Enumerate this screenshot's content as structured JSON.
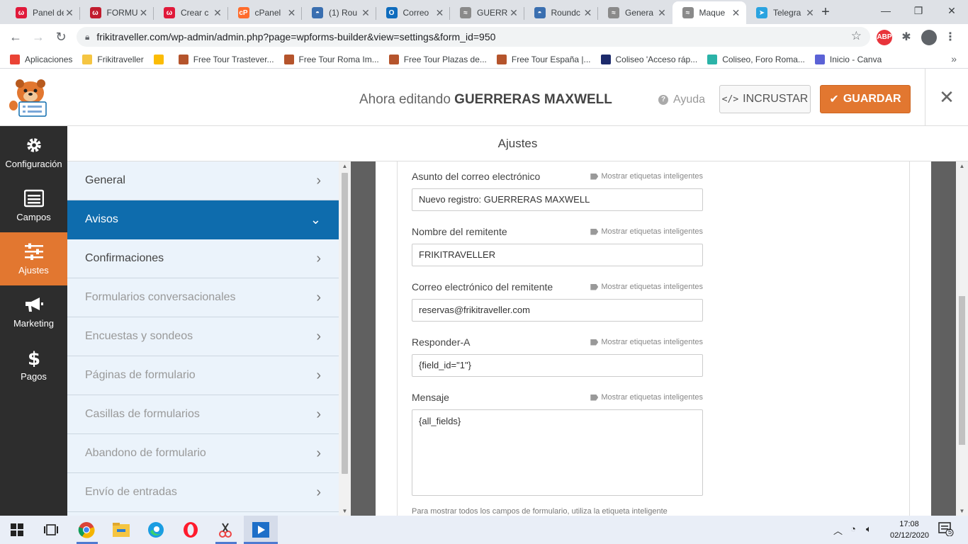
{
  "browser": {
    "tabs": [
      {
        "title": "Panel de",
        "icon_color": "#e0193a",
        "glyph": "ω"
      },
      {
        "title": "FORMUL",
        "icon_color": "#c11c2e",
        "glyph": "ω"
      },
      {
        "title": "Crear c",
        "icon_color": "#e0193a",
        "glyph": "ω"
      },
      {
        "title": "cPanel",
        "icon_color": "#ff6c2c",
        "glyph": "cP"
      },
      {
        "title": "(1) Rou",
        "icon_color": "#3a6fb0",
        "glyph": "◓"
      },
      {
        "title": "Correo",
        "icon_color": "#0f6cbd",
        "glyph": "O"
      },
      {
        "title": "GUERR",
        "icon_color": "#8a8a8a",
        "glyph": "≈"
      },
      {
        "title": "Roundc",
        "icon_color": "#3a6fb0",
        "glyph": "◓"
      },
      {
        "title": "Genera",
        "icon_color": "#8a8a8a",
        "glyph": "≈"
      },
      {
        "title": "Maque",
        "icon_color": "#8a8a8a",
        "glyph": "≈"
      },
      {
        "title": "Telegra",
        "icon_color": "#2aa3e0",
        "glyph": "➤"
      }
    ],
    "close_glyph": "✕",
    "new_tab_glyph": "+",
    "url": "frikitraveller.com/wp-admin/admin.php?page=wpforms-builder&view=settings&form_id=950",
    "abp_label": "ABP",
    "bookmarks": [
      {
        "label": "Aplicaciones",
        "color": "#ea4335"
      },
      {
        "label": "Frikitraveller",
        "color": "#f5c542"
      },
      {
        "label": "",
        "color": "#fbbc05"
      },
      {
        "label": "Free Tour Trastever...",
        "color": "#b5542c"
      },
      {
        "label": "Free Tour Roma Im...",
        "color": "#b5542c"
      },
      {
        "label": "Free Tour Plazas de...",
        "color": "#b5542c"
      },
      {
        "label": "Free Tour España |...",
        "color": "#b5542c"
      },
      {
        "label": "Coliseo 'Acceso ráp...",
        "color": "#1c2a6b"
      },
      {
        "label": "Coliseo, Foro Roma...",
        "color": "#2bb3a8"
      },
      {
        "label": "Inicio - Canva",
        "color": "#5b62d6"
      }
    ]
  },
  "header": {
    "editing_prefix": "Ahora editando",
    "form_name": "GUERRERAS MAXWELL",
    "help_label": "Ayuda",
    "embed_label": "INCRUSTAR",
    "save_label": "GUARDAR"
  },
  "leftnav": [
    {
      "label": "Configuración",
      "icon": "gear-icon"
    },
    {
      "label": "Campos",
      "icon": "fields-icon"
    },
    {
      "label": "Ajustes",
      "icon": "sliders-icon",
      "active": true
    },
    {
      "label": "Marketing",
      "icon": "megaphone-icon"
    },
    {
      "label": "Pagos",
      "icon": "dollar-icon"
    }
  ],
  "panel_title": "Ajustes",
  "settings_menu": [
    {
      "label": "General",
      "state": "enabled"
    },
    {
      "label": "Avisos",
      "state": "active"
    },
    {
      "label": "Confirmaciones",
      "state": "enabled"
    },
    {
      "label": "Formularios conversacionales",
      "state": "disabled"
    },
    {
      "label": "Encuestas y sondeos",
      "state": "disabled"
    },
    {
      "label": "Páginas de formulario",
      "state": "disabled"
    },
    {
      "label": "Casillas de formularios",
      "state": "disabled"
    },
    {
      "label": "Abandono de formulario",
      "state": "disabled"
    },
    {
      "label": "Envío de entradas",
      "state": "disabled"
    }
  ],
  "smart_tags_label": "Mostrar etiquetas inteligentes",
  "fields": [
    {
      "label": "Asunto del correo electrónico",
      "value": "Nuevo registro: GUERRERAS MAXWELL",
      "type": "input"
    },
    {
      "label": "Nombre del remitente",
      "value": "FRIKITRAVELLER",
      "type": "input"
    },
    {
      "label": "Correo electrónico del remitente",
      "value": "reservas@frikitraveller.com",
      "type": "input"
    },
    {
      "label": "Responder-A",
      "value": "{field_id=\"1\"}",
      "type": "input"
    },
    {
      "label": "Mensaje",
      "value": "{all_fields}",
      "type": "textarea"
    }
  ],
  "hint_text": "Para mostrar todos los campos de formulario, utiliza la etiqueta inteligente",
  "taskbar": {
    "time": "17:08",
    "date": "02/12/2020",
    "notification_count": "5"
  }
}
